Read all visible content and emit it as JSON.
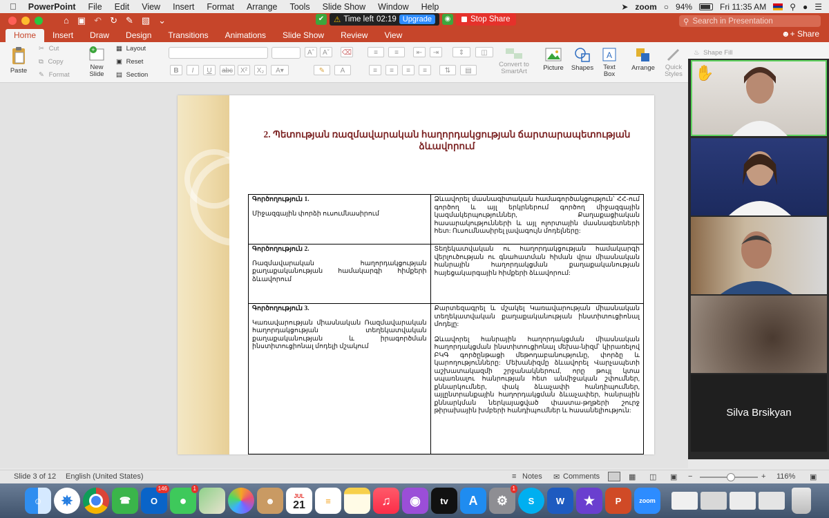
{
  "menubar": {
    "app_name": "PowerPoint",
    "items": [
      "File",
      "Edit",
      "View",
      "Insert",
      "Format",
      "Arrange",
      "Tools",
      "Slide Show",
      "Window",
      "Help"
    ],
    "zoom_label": "zoom",
    "battery": "94%",
    "clock": "Fri 11:35 AM"
  },
  "zoom_share": {
    "time_left_label": "Time left",
    "time_left_value": "02:19",
    "upgrade_label": "Upgrade",
    "stop_label": "Stop Share"
  },
  "title_bar": {
    "search_placeholder": "Search in Presentation"
  },
  "tabs": [
    "Home",
    "Insert",
    "Draw",
    "Design",
    "Transitions",
    "Animations",
    "Slide Show",
    "Review",
    "View"
  ],
  "share_label": "Share",
  "ribbon": {
    "paste": "Paste",
    "cut": "Cut",
    "copy": "Copy",
    "format": "Format",
    "new_slide": "New\nSlide",
    "layout": "Layout",
    "reset": "Reset",
    "section": "Section",
    "convert": "Convert to\nSmartArt",
    "picture": "Picture",
    "shapes": "Shapes",
    "text_box": "Text\nBox",
    "arrange": "Arrange",
    "quick_styles": "Quick\nStyles",
    "shape_fill": "Shape Fill",
    "bold": "B",
    "italic": "I",
    "underline": "U",
    "strike": "abc",
    "superscript": "X²",
    "subscript": "X₂"
  },
  "slide": {
    "title": "2. Պետության ռազմավարական հաղորդակցության ճարտարապետության ձևավորում",
    "rows": [
      {
        "activity": "Գործողություն 1.",
        "goal": "Միջազգային փորձի ուսումնասիրում",
        "description": [
          "Ձևավորել մասնագիտական համագործակցություն՝ ՀՀ-ում գործող և այլ երկրներում գործող միջազգային կազմակերպություններ, Քաղաքացիական հասարակությունների և այլ ոլորտային մասնագետների հետ: Ուսումնասիրել լավագույն մոդելները:"
        ]
      },
      {
        "activity": "Գործողություն 2.",
        "goal": "Ռազմավարական հաղորդակցության քաղաքականության համակարգի հիմքերի ձևավորում",
        "description": [
          "Տեղեկատվական ու հաղորդակցության համակարգի վերլուծության ու գնահատման հիման վրա միասնական հանրային հաղորդակցման քաղաքականության հայեցակարգային հիմքերի ձևավորում:"
        ]
      },
      {
        "activity": "Գործողություն 3.",
        "goal": "Կառավարության միասնական Ռազմավարական հաղորդակցության տեղեկատվական քաղաքականության և իրագործման ինստիտուցիոնալ մոդելի մշակում",
        "description": [
          "Քարտեզագրել և մշակել Կառավարության միասնական տեղեկատվական քաղաքականության ինստիտուցիոնալ մոդելը:",
          "Ձևավորել հանրային հաղորդակցման միասնական հաղորդակցման ինստիտուցիոնալ մեխա-նիզմ՝ կիրառելով ԲԿԳ գործընթացի մեթոդաբանությունը, փորձը և կարողությունները: Մեխանիզմը ձևավորել Վարչապետի աշխատակազմի շրջանակներում, որը թույլ կտա սպառնալու հանրության հետ անմիջական շփումներ, քննարկումներ, փակ ձևաչափի հանդիպումներ, այլընտրանքային հաղորդակցման ձևաչափեր, հանրային քննարկման ներկայացված փաստա-թղթերի շուրջ թիրախային խմբերի հանդիպումներ և հասանելիություն:"
        ]
      }
    ]
  },
  "participants": {
    "named_tile": "Silva Brsikyan"
  },
  "status": {
    "slide_info": "Slide 3 of 12",
    "language": "English (United States)",
    "notes": "Notes",
    "comments": "Comments",
    "zoom": "116%"
  },
  "dock": {
    "outlook_badge": "146",
    "messages_badge": "1",
    "preferences_badge": "1",
    "calendar_month": "JUL",
    "calendar_day": "21",
    "tv_label": "tv",
    "zoom_label": "zoom",
    "skype_label": "S",
    "word_label": "W",
    "ppt_label": "P"
  }
}
